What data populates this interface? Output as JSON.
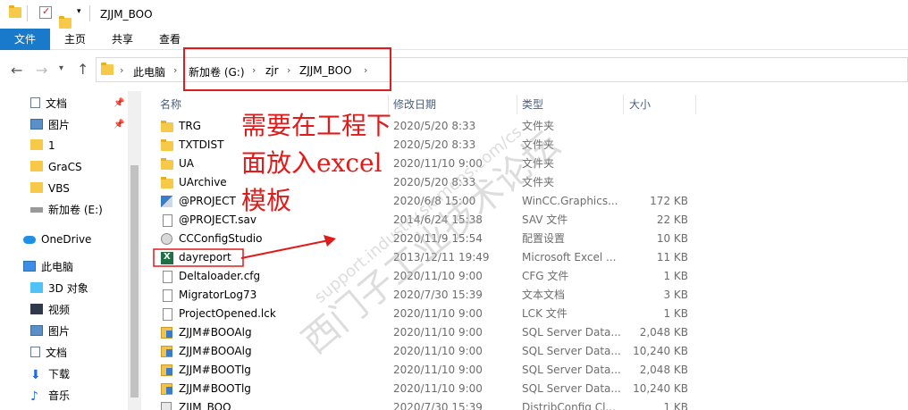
{
  "title": "ZJJM_BOO",
  "ribbon": {
    "tabs": [
      "文件",
      "主页",
      "共享",
      "查看"
    ]
  },
  "breadcrumb": [
    "此电脑",
    "新加卷 (G:)",
    "zjr",
    "ZJJM_BOO"
  ],
  "nav": {
    "items": [
      {
        "label": "文档",
        "icon": "document-icon",
        "pinned": true
      },
      {
        "label": "图片",
        "icon": "picture-icon",
        "pinned": true
      },
      {
        "label": "1",
        "icon": "folder-icon"
      },
      {
        "label": "GraCS",
        "icon": "folder-icon"
      },
      {
        "label": "VBS",
        "icon": "folder-icon"
      },
      {
        "label": "新加卷 (E:)",
        "icon": "drive-icon"
      },
      {
        "label": "OneDrive",
        "icon": "onedrive-icon"
      },
      {
        "label": "此电脑",
        "icon": "computer-icon"
      },
      {
        "label": "3D 对象",
        "icon": "3d-objects-icon"
      },
      {
        "label": "视频",
        "icon": "video-icon"
      },
      {
        "label": "图片",
        "icon": "picture-icon"
      },
      {
        "label": "文档",
        "icon": "document-icon"
      },
      {
        "label": "下载",
        "icon": "download-icon"
      },
      {
        "label": "音乐",
        "icon": "music-icon"
      }
    ]
  },
  "columns": {
    "name": "名称",
    "date": "修改日期",
    "type": "类型",
    "size": "大小"
  },
  "files": [
    {
      "name": "TRG",
      "date": "2020/5/20 8:33",
      "type": "文件夹",
      "size": "",
      "icon": "folder"
    },
    {
      "name": "TXTDIST",
      "date": "2020/5/20 8:33",
      "type": "文件夹",
      "size": "",
      "icon": "folder"
    },
    {
      "name": "UA",
      "date": "2020/11/10 9:00",
      "type": "文件夹",
      "size": "",
      "icon": "folder"
    },
    {
      "name": "UArchive",
      "date": "2020/5/20 8:33",
      "type": "文件夹",
      "size": "",
      "icon": "folder"
    },
    {
      "name": "@PROJECT",
      "date": "2020/6/8 15:00",
      "type": "WinCC.Graphics...",
      "size": "172 KB",
      "icon": "wincc"
    },
    {
      "name": "@PROJECT.sav",
      "date": "2014/6/24 15:38",
      "type": "SAV 文件",
      "size": "22 KB",
      "icon": "doc"
    },
    {
      "name": "CCConfigStudio",
      "date": "2020/11/9 15:54",
      "type": "配置设置",
      "size": "10 KB",
      "icon": "cfg"
    },
    {
      "name": "dayreport",
      "date": "2013/12/11 19:49",
      "type": "Microsoft Excel ...",
      "size": "11 KB",
      "icon": "xls"
    },
    {
      "name": "Deltaloader.cfg",
      "date": "2020/11/10 9:00",
      "type": "CFG 文件",
      "size": "1 KB",
      "icon": "doc"
    },
    {
      "name": "MigratorLog73",
      "date": "2020/7/30 15:39",
      "type": "文本文档",
      "size": "3 KB",
      "icon": "doc"
    },
    {
      "name": "ProjectOpened.lck",
      "date": "2020/11/10 9:00",
      "type": "LCK 文件",
      "size": "1 KB",
      "icon": "doc"
    },
    {
      "name": "ZJJM#BOOAlg",
      "date": "2020/11/10 9:00",
      "type": "SQL Server Data...",
      "size": "2,048 KB",
      "icon": "sql"
    },
    {
      "name": "ZJJM#BOOAlg",
      "date": "2020/11/10 9:00",
      "type": "SQL Server Data...",
      "size": "10,240 KB",
      "icon": "sql"
    },
    {
      "name": "ZJJM#BOOTlg",
      "date": "2020/11/10 9:00",
      "type": "SQL Server Data...",
      "size": "2,048 KB",
      "icon": "sql"
    },
    {
      "name": "ZJJM#BOOTlg",
      "date": "2020/11/10 9:00",
      "type": "SQL Server Data...",
      "size": "10,240 KB",
      "icon": "sql"
    },
    {
      "name": "ZJJM_BOO",
      "date": "2020/7/30 15:39",
      "type": "DistribConfig Cl...",
      "size": "1 KB",
      "icon": "dist"
    }
  ],
  "annotation": "需要在工程下面放入excel模板",
  "watermark": {
    "main": "西门子工业技术论坛",
    "sub": "support.industry.siemens.com/cs"
  },
  "colors": {
    "accent": "#1979ca",
    "annotation": "#e01b1b",
    "excel": "#1e7145"
  }
}
